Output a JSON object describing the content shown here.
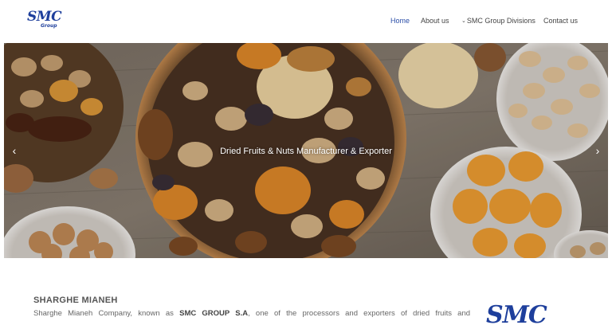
{
  "header": {
    "logo_main": "SMC",
    "logo_sub": "Group",
    "nav": {
      "home": "Home",
      "about": "About us",
      "divisions": "SMC Group Divisions",
      "contact": "Contact us"
    }
  },
  "hero": {
    "caption": "Dried Fruits & Nuts Manufacturer & Exporter",
    "prev_icon": "‹",
    "next_icon": "›"
  },
  "content": {
    "title": "SHARGHE MIANEH",
    "text_before": "Sharghe Mianeh Company, known as ",
    "text_bold": "SMC GROUP S.A",
    "text_after": ", one of the processors and exporters of dried fruits and",
    "side_logo": "SMC"
  },
  "colors": {
    "brand": "#1e3f9c",
    "nav_active": "#2c4fa8"
  }
}
